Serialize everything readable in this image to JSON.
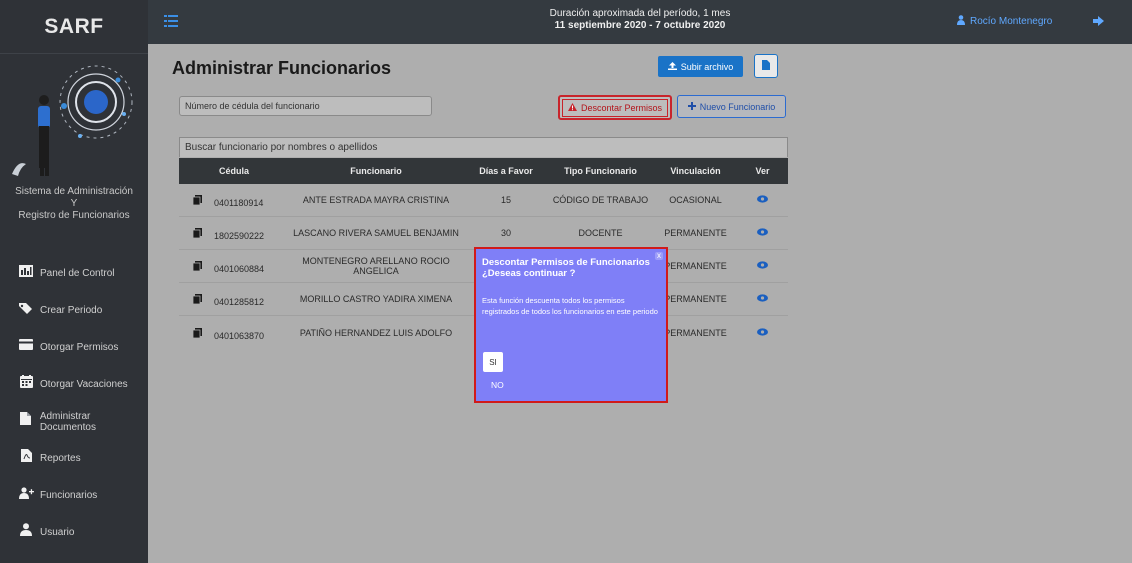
{
  "app": {
    "brand": "SARF"
  },
  "sidebar": {
    "system_line1": "Sistema de Administración",
    "system_line2": "Y",
    "system_line3": "Registro de Funcionarios",
    "items": [
      {
        "label": "Panel de Control",
        "icon": "chart-icon"
      },
      {
        "label": "Crear Periodo",
        "icon": "tag-icon"
      },
      {
        "label": "Otorgar Permisos",
        "icon": "card-icon"
      },
      {
        "label": "Otorgar Vacaciones",
        "icon": "calendar-icon"
      },
      {
        "label": "Administrar Documentos",
        "icon": "file-icon"
      },
      {
        "label": "Reportes",
        "icon": "pdf-file-icon"
      },
      {
        "label": "Funcionarios",
        "icon": "users-icon"
      },
      {
        "label": "Usuario",
        "icon": "user-icon"
      }
    ]
  },
  "topbar": {
    "period_line1": "Duración aproximada del período, 1 mes",
    "period_line2": "11 septiembre 2020 - 7 octubre 2020",
    "user_name": "Rocío Montenegro"
  },
  "main": {
    "title": "Administrar Funcionarios",
    "upload_label": "Subir archivo",
    "cedula_placeholder": "Número de cédula del funcionario",
    "descontar_label": "Descontar Permisos",
    "nuevo_label": "Nuevo Funcionario",
    "search_placeholder": "Buscar funcionario por nombres o apellidos"
  },
  "table": {
    "headers": {
      "cedula": "Cédula",
      "funcionario": "Funcionario",
      "dias": "Días a Favor",
      "tipo": "Tipo Funcionario",
      "vinculacion": "Vinculación",
      "ver": "Ver"
    },
    "rows": [
      {
        "cedula": "0401180914",
        "funcionario": "ANTE ESTRADA MAYRA CRISTINA",
        "dias": "15",
        "tipo": "CÓDIGO DE TRABAJO",
        "vinculacion": "OCASIONAL"
      },
      {
        "cedula": "1802590222",
        "funcionario": "LASCANO RIVERA SAMUEL BENJAMIN",
        "dias": "30",
        "tipo": "DOCENTE",
        "vinculacion": "PERMANENTE"
      },
      {
        "cedula": "0401060884",
        "funcionario": "MONTENEGRO ARELLANO ROCIO ANGELICA",
        "dias": "",
        "tipo": "",
        "vinculacion": "PERMANENTE"
      },
      {
        "cedula": "0401285812",
        "funcionario": "MORILLO CASTRO YADIRA XIMENA",
        "dias": "",
        "tipo": "",
        "vinculacion": "PERMANENTE"
      },
      {
        "cedula": "0401063870",
        "funcionario": "PATIÑO HERNANDEZ LUIS ADOLFO",
        "dias": "",
        "tipo": "",
        "vinculacion": "PERMANENTE"
      }
    ]
  },
  "dialog": {
    "title_line1": "Descontar Permisos de Funcionarios",
    "title_line2": "¿Deseas continuar ?",
    "body": "Esta función descuenta todos los permisos registrados de todos los funcionarios en este periodo",
    "yes_label": "SI",
    "no_label": "NO",
    "close_label": "x"
  },
  "colors": {
    "sidebar_bg": "#2f3237",
    "topbar_bg": "#343a40",
    "overlay_bg": "#aeaeae",
    "primary": "#1a73c7",
    "danger": "#c8242b",
    "dialog_bg": "#7f7ff7"
  }
}
